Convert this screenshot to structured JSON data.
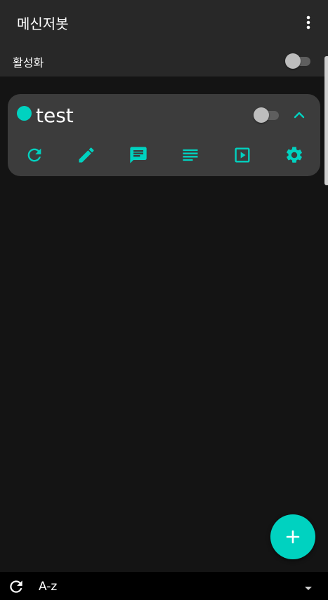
{
  "app": {
    "title": "메신저봇"
  },
  "activation": {
    "label": "활성화",
    "enabled": false
  },
  "bots": [
    {
      "name": "test",
      "enabled": false,
      "status_color": "#00d2c0",
      "expanded": true
    }
  ],
  "card_actions": [
    {
      "name": "reload",
      "icon": "refresh-icon"
    },
    {
      "name": "edit",
      "icon": "pencil-icon"
    },
    {
      "name": "chat",
      "icon": "chat-icon"
    },
    {
      "name": "log",
      "icon": "log-lines-icon"
    },
    {
      "name": "run",
      "icon": "play-box-icon"
    },
    {
      "name": "settings",
      "icon": "gear-icon"
    }
  ],
  "fab": {
    "icon": "plus-icon"
  },
  "sort": {
    "label": "A-z"
  },
  "colors": {
    "accent": "#00d2c0",
    "background": "#141414",
    "toolbar": "#282828",
    "card": "#3c3c3c"
  }
}
